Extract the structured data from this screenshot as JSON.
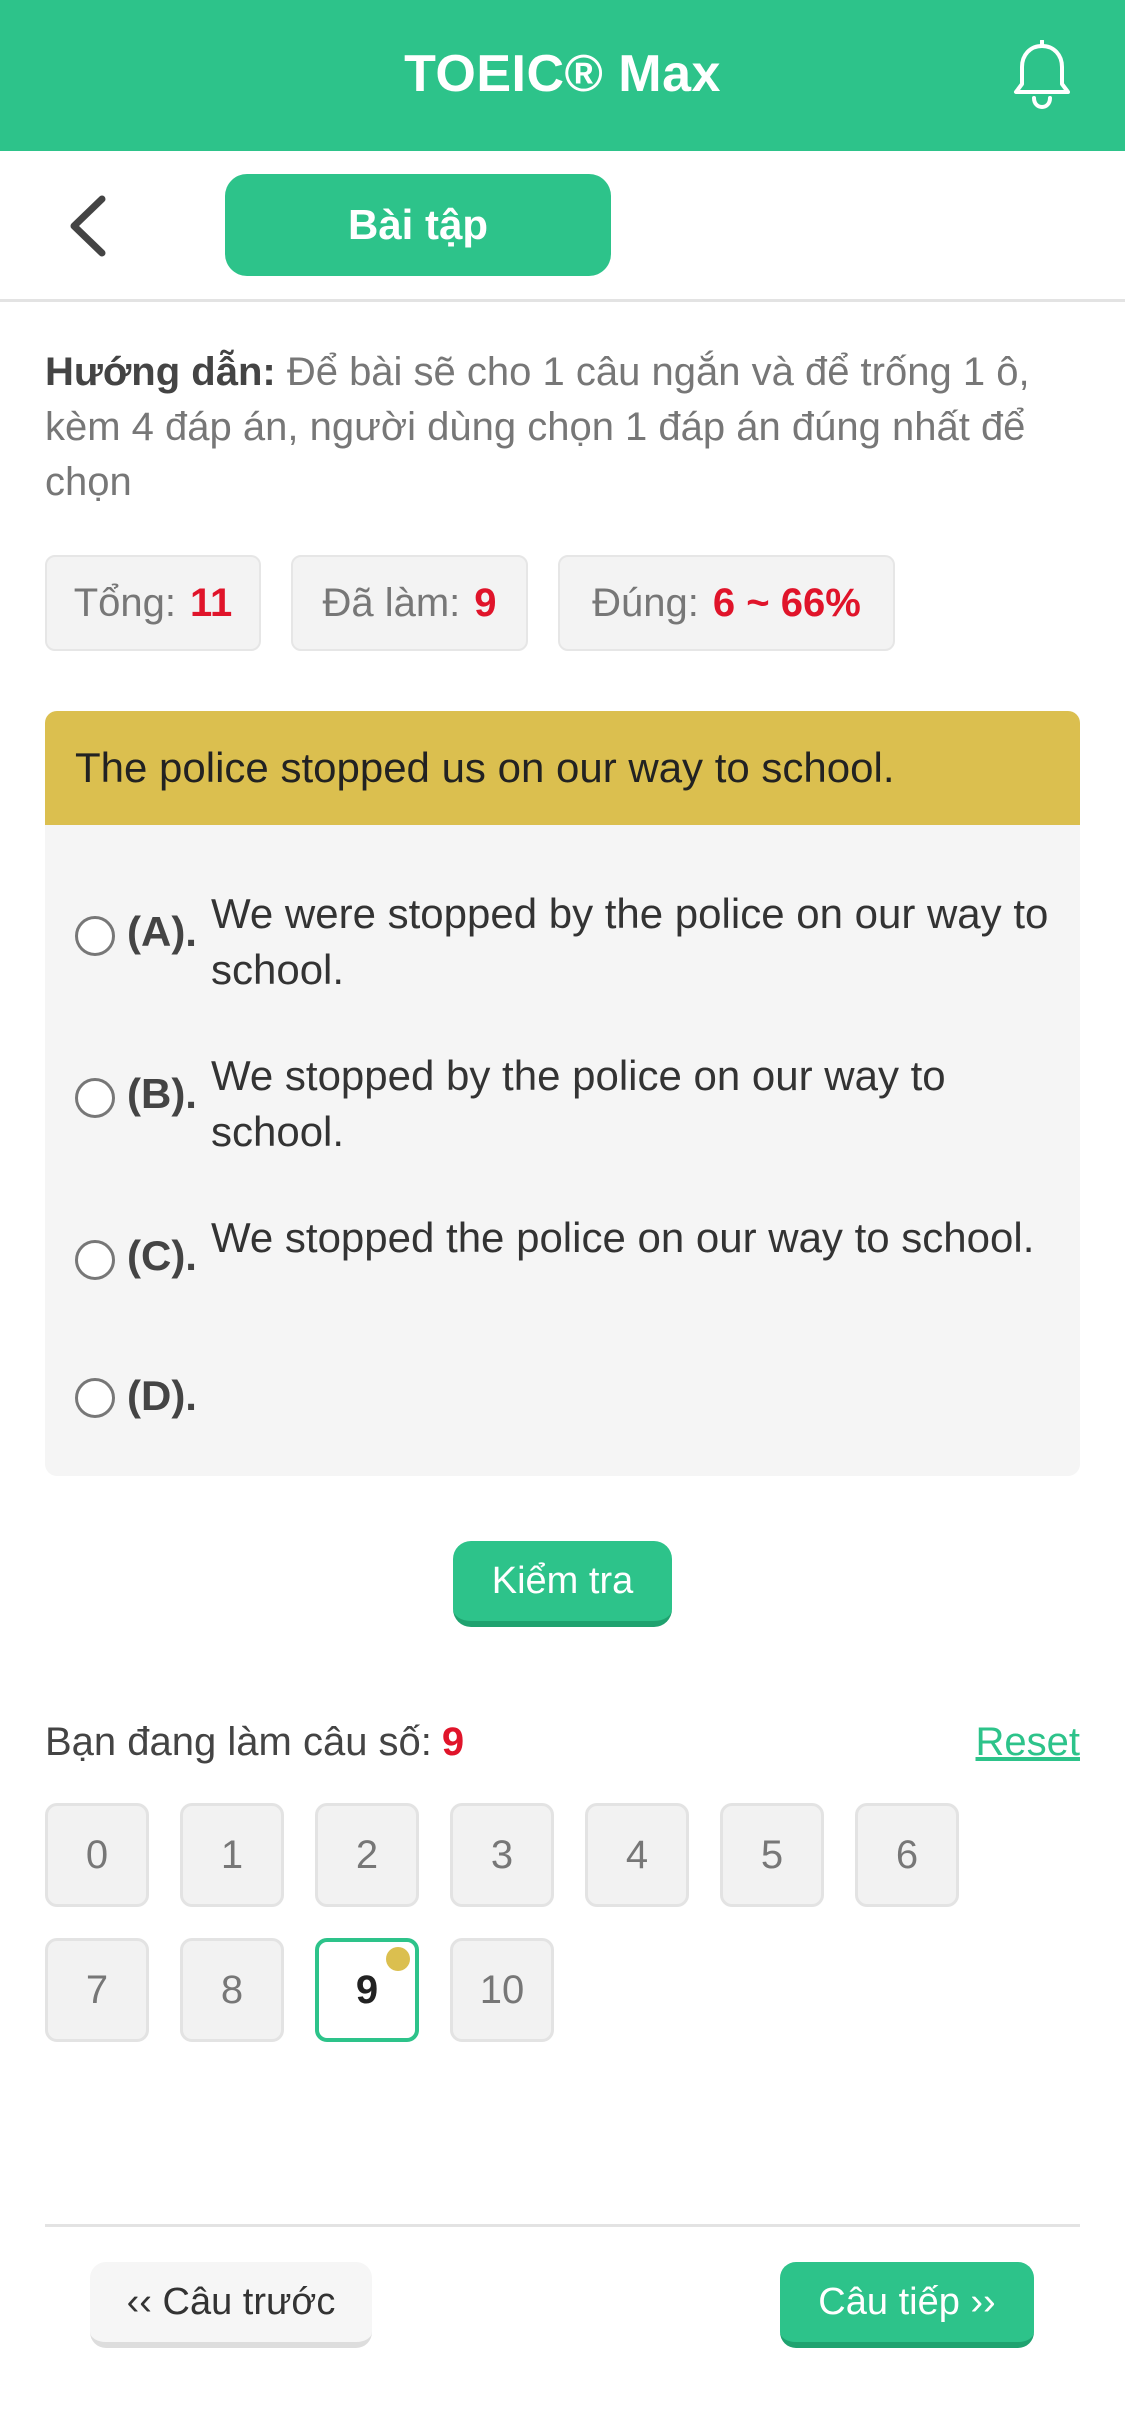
{
  "header": {
    "title": "TOEIC® Max",
    "bell_icon": "bell-icon"
  },
  "subnav": {
    "back_icon": "chevron-left-icon",
    "tab_label": "Bài tập"
  },
  "instruction": {
    "label": "Hướng dẫn:",
    "text": " Để bài sẽ cho 1 câu ngắn và để trống 1 ô, kèm 4 đáp án, người dùng chọn 1 đáp án đúng nhất để chọn"
  },
  "stats": {
    "total_label": "Tổng:",
    "total_value": "11",
    "done_label": "Đã làm:",
    "done_value": "9",
    "correct_label": "Đúng:",
    "correct_value": "6 ~ 66%"
  },
  "question": {
    "prompt": "The police stopped us on our way to school.",
    "options": [
      {
        "letter": "(A).",
        "text": "We were stopped by the police on our way to school."
      },
      {
        "letter": "(B).",
        "text": "We stopped by the police on our way to school."
      },
      {
        "letter": "(C).",
        "text": "We stopped the police on our way to school."
      },
      {
        "letter": "(D).",
        "text": ""
      }
    ]
  },
  "check_button": "Kiểm tra",
  "progress": {
    "label": "Bạn đang làm câu số:",
    "current": "9",
    "reset": "Reset",
    "numbers": [
      "0",
      "1",
      "2",
      "3",
      "4",
      "5",
      "6",
      "7",
      "8",
      "9",
      "10"
    ],
    "current_index": 9
  },
  "navigation": {
    "prev": "‹‹ Câu trước",
    "next": "Câu tiếp ››"
  },
  "colors": {
    "accent": "#2dc38a",
    "prompt_bg": "#dbbf4f",
    "highlight": "#e0142a"
  }
}
